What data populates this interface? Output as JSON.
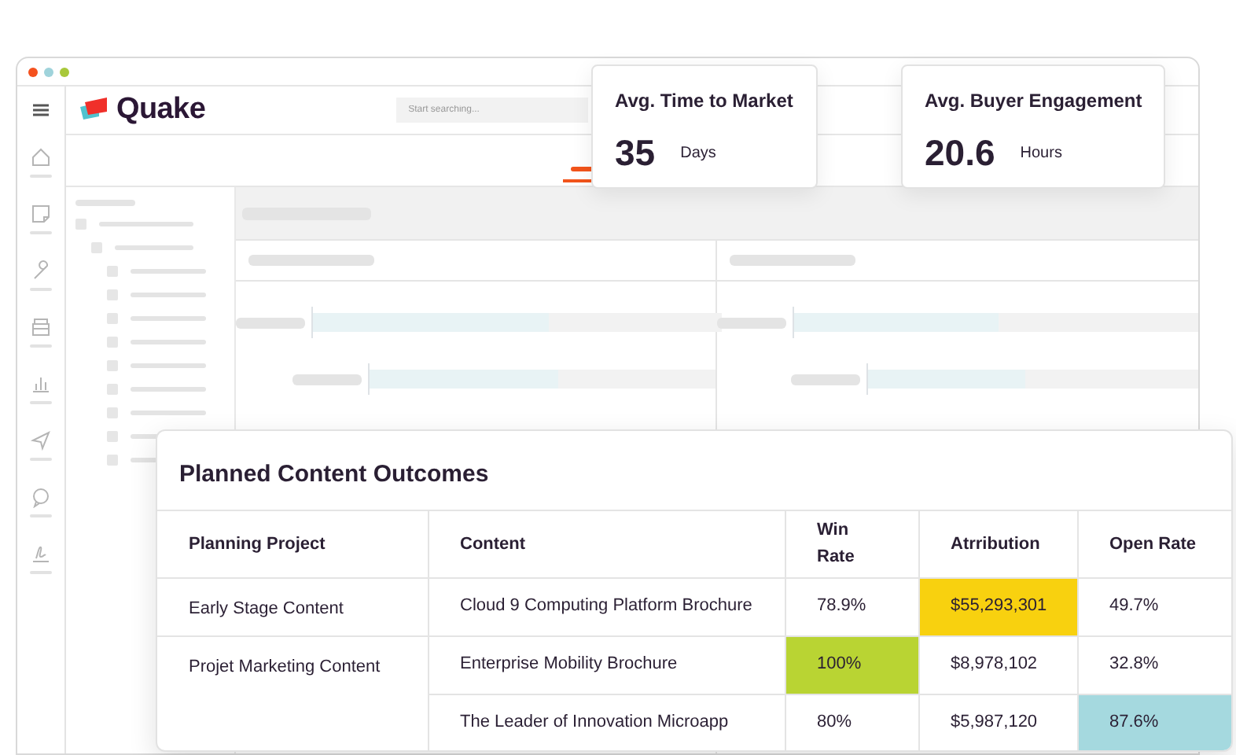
{
  "app": {
    "logo": "Quake",
    "search": {
      "placeholder": "Start searching..."
    }
  },
  "stats": [
    {
      "title": "Avg. Time to Market",
      "value": "35",
      "unit": "Days"
    },
    {
      "title": "Avg. Buyer Engagement",
      "value": "20.6",
      "unit": "Hours"
    }
  ],
  "outcomes": {
    "title": "Planned Content Outcomes",
    "columns": [
      "Planning Project",
      "Content",
      "Win Rate",
      "Atrribution",
      "Open Rate"
    ],
    "rows": [
      {
        "cells": [
          {
            "text": "Early Stage Content"
          },
          {
            "text": "Cloud 9 Computing Platform Brochure"
          },
          {
            "text": "78.9%"
          },
          {
            "text": "$55,293,301",
            "color": "#f8d10f"
          },
          {
            "text": "49.7%"
          }
        ]
      },
      {
        "cells": [
          {
            "text": "Projet Marketing Content",
            "rowspan": 2
          },
          {
            "text": "Enterprise Mobility Brochure"
          },
          {
            "text": "100%",
            "color": "#b9d433"
          },
          {
            "text": "$8,978,102"
          },
          {
            "text": "32.8%"
          }
        ]
      },
      {
        "cells": [
          {
            "text": "The Leader of Innovation Microapp"
          },
          {
            "text": "80%"
          },
          {
            "text": "$5,987,120"
          },
          {
            "text": "87.6%",
            "color": "#a5d9df"
          }
        ]
      }
    ]
  }
}
